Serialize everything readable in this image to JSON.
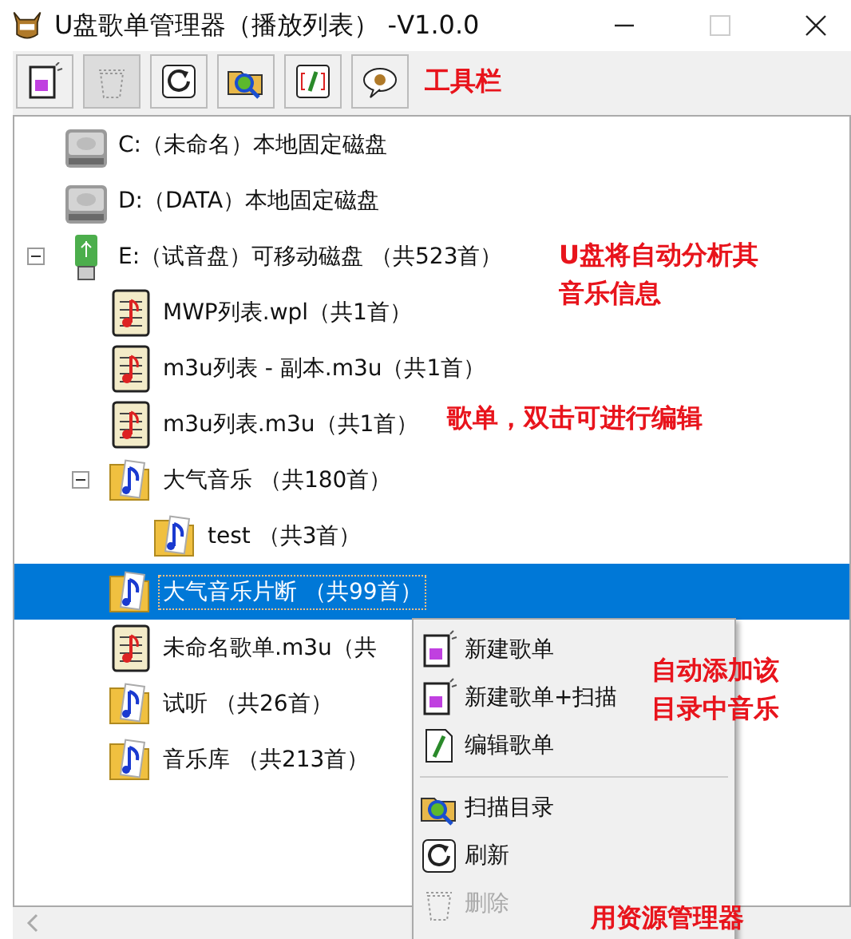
{
  "window": {
    "title": "U盘歌单管理器（播放列表） -V1.0.0"
  },
  "toolbar": {
    "buttons": [
      {
        "kind": "new",
        "disabled": false
      },
      {
        "kind": "delete",
        "disabled": true
      },
      {
        "kind": "refresh",
        "disabled": false
      },
      {
        "kind": "scan",
        "disabled": false
      },
      {
        "kind": "edit",
        "disabled": false
      },
      {
        "kind": "about",
        "disabled": false
      }
    ],
    "note": "工具栏"
  },
  "tree": [
    {
      "kind": "drive",
      "label": "C:（未命名）本地固定磁盘",
      "selected": false
    },
    {
      "kind": "drive",
      "label": "D:（DATA）本地固定磁盘",
      "selected": false
    },
    {
      "kind": "usb",
      "label": "E:（试音盘）可移动磁盘 （共523首）",
      "selected": false,
      "expanded": true,
      "children": [
        {
          "kind": "playlist",
          "label": "MWP列表.wpl（共1首）",
          "selected": false
        },
        {
          "kind": "playlist",
          "label": "m3u列表 - 副本.m3u（共1首）",
          "selected": false
        },
        {
          "kind": "playlist",
          "label": "m3u列表.m3u（共1首）",
          "selected": false
        },
        {
          "kind": "folder",
          "label": "大气音乐 （共180首）",
          "selected": false,
          "expanded": true,
          "children": [
            {
              "kind": "folder",
              "label": "test （共3首）",
              "selected": false
            }
          ]
        },
        {
          "kind": "folder",
          "label": "大气音乐片断 （共99首）",
          "selected": true
        },
        {
          "kind": "playlist",
          "label": "未命名歌单.m3u（共",
          "selected": false
        },
        {
          "kind": "folder",
          "label": "试听 （共26首）",
          "selected": false
        },
        {
          "kind": "folder",
          "label": "音乐库 （共213首）",
          "selected": false
        }
      ]
    }
  ],
  "context_menu": [
    {
      "kind": "new",
      "label": "新建歌单",
      "disabled": false
    },
    {
      "kind": "new",
      "label": "新建歌单+扫描",
      "disabled": false
    },
    {
      "kind": "edit",
      "label": "编辑歌单",
      "disabled": false
    },
    {
      "kind": "separator"
    },
    {
      "kind": "scan",
      "label": "扫描目录",
      "disabled": false
    },
    {
      "kind": "refresh",
      "label": "刷新",
      "disabled": false
    },
    {
      "kind": "delete",
      "label": "删除",
      "disabled": true
    }
  ],
  "annotations": [
    {
      "lines": [
        "U盘将自动分析其",
        "音乐信息"
      ]
    },
    {
      "lines": [
        "歌单，双击可进行编辑"
      ]
    },
    {
      "lines": [
        "自动添加该",
        "目录中音乐"
      ]
    },
    {
      "lines": [
        "用资源管理器"
      ]
    }
  ]
}
